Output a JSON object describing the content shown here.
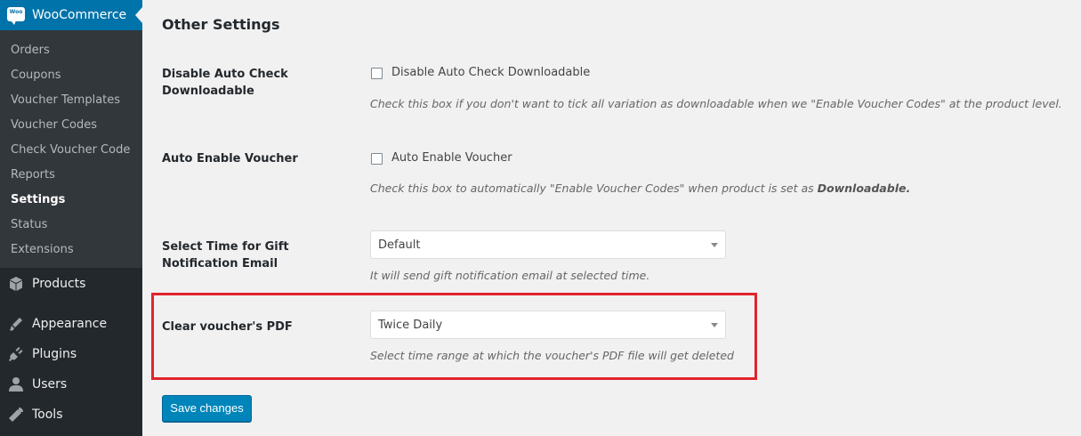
{
  "sidebar": {
    "woocommerce_title": "WooCommerce",
    "woo_logo_text": "Woo",
    "submenu": [
      {
        "label": "Orders"
      },
      {
        "label": "Coupons"
      },
      {
        "label": "Voucher Templates"
      },
      {
        "label": "Voucher Codes"
      },
      {
        "label": "Check Voucher Code"
      },
      {
        "label": "Reports"
      },
      {
        "label": "Settings",
        "current": true
      },
      {
        "label": "Status"
      },
      {
        "label": "Extensions"
      }
    ],
    "menu": [
      {
        "label": "Products",
        "icon": "products-icon"
      },
      {
        "label": "Appearance",
        "icon": "appearance-icon"
      },
      {
        "label": "Plugins",
        "icon": "plugins-icon"
      },
      {
        "label": "Users",
        "icon": "users-icon"
      },
      {
        "label": "Tools",
        "icon": "tools-icon"
      }
    ]
  },
  "main": {
    "section_title": "Other Settings",
    "rows": {
      "disable_auto_check": {
        "label_line1": "Disable Auto Check",
        "label_line2": "Downloadable",
        "checkbox_label": "Disable Auto Check Downloadable",
        "checked": false,
        "description": "Check this box if you don't want to tick all variation as downloadable when we \"Enable Voucher Codes\" at the product level."
      },
      "auto_enable_voucher": {
        "label": "Auto Enable Voucher",
        "checkbox_label": "Auto Enable Voucher",
        "checked": false,
        "description_prefix": "Check this box to automatically \"Enable Voucher Codes\" when product is set as ",
        "description_bold": "Downloadable."
      },
      "gift_notification_time": {
        "label_line1": "Select Time for Gift",
        "label_line2": "Notification Email",
        "selected": "Default",
        "description": "It will send gift notification email at selected time."
      },
      "clear_voucher_pdf": {
        "label": "Clear voucher's PDF",
        "selected": "Twice Daily",
        "description": "Select time range at which the voucher's PDF file will get deleted"
      }
    },
    "save_label": "Save changes"
  },
  "colors": {
    "sidebar_bg": "#23282d",
    "submenu_bg": "#32373c",
    "accent": "#0073aa",
    "button": "#0085ba",
    "highlight": "#e2242c"
  }
}
